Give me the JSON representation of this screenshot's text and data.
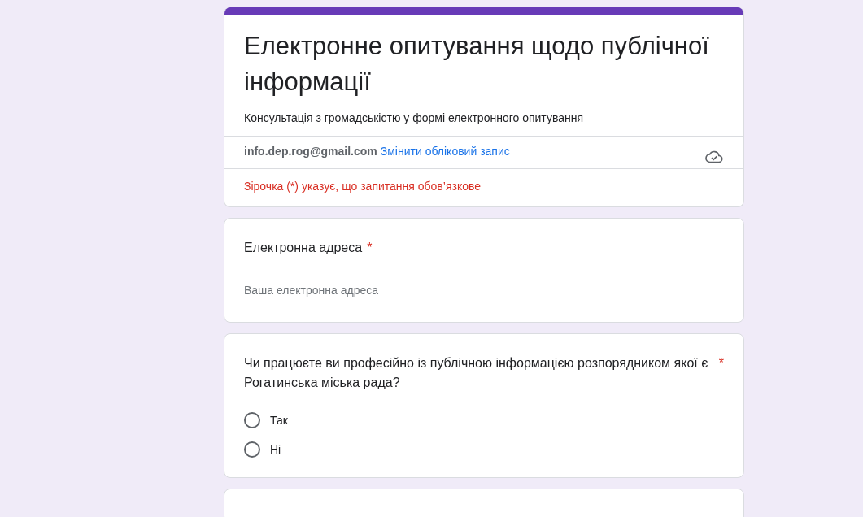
{
  "header": {
    "title": "Електронне опитування щодо публічної інформації",
    "description": "Консультація з громадськістю у формі електронного опитування",
    "account_email": "info.dep.rog@gmail.com",
    "switch_account_link": "Змінити обліковий запис",
    "required_note": "Зірочка (*) указує, що запитання обов’язкове"
  },
  "questions": [
    {
      "kind": "text",
      "title": "Електронна адреса",
      "required": true,
      "required_mark": "*",
      "placeholder": "Ваша електронна адреса"
    },
    {
      "kind": "radio",
      "title": "Чи працюєте ви професійно із публічною інформацією розпорядником якої є Рогатинська міська рада?",
      "required": true,
      "required_mark": "*",
      "options": [
        {
          "label": "Так",
          "selected": false
        },
        {
          "label": "Ні",
          "selected": false
        }
      ]
    }
  ]
}
